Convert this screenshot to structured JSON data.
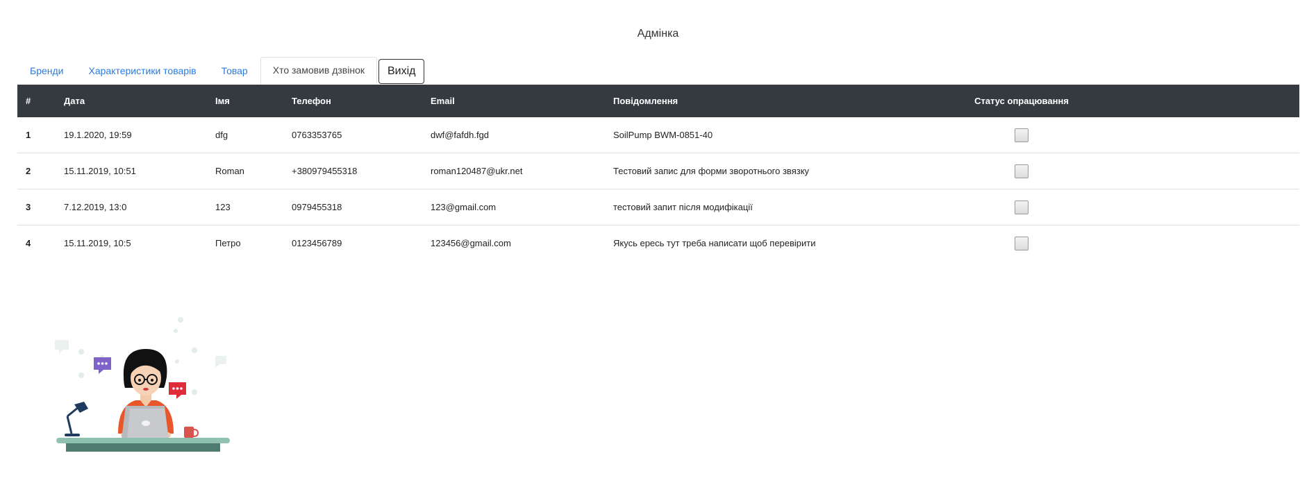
{
  "header": {
    "title": "Адмінка"
  },
  "tabs": [
    {
      "label": "Бренди",
      "active": false
    },
    {
      "label": "Характеристики товарів",
      "active": false
    },
    {
      "label": "Товар",
      "active": false
    },
    {
      "label": "Хто замовив дзвінок",
      "active": true
    }
  ],
  "logout_label": "Вихід",
  "table": {
    "columns": [
      "#",
      "Дата",
      "Імя",
      "Телефон",
      "Email",
      "Повідомлення",
      "Статус опрацювання"
    ],
    "rows": [
      {
        "num": "1",
        "date": "19.1.2020, 19:59",
        "name": "dfg",
        "phone": "0763353765",
        "email": "dwf@fafdh.fgd",
        "message": "SoilPump BWM-0851-40",
        "processed": false
      },
      {
        "num": "2",
        "date": "15.11.2019, 10:51",
        "name": "Roman",
        "phone": "+380979455318",
        "email": "roman120487@ukr.net",
        "message": "Тестовий запис для форми зворотнього звязку",
        "processed": false
      },
      {
        "num": "3",
        "date": "7.12.2019, 13:0",
        "name": "123",
        "phone": "0979455318",
        "email": "123@gmail.com",
        "message": "тестовий запит після модифікації",
        "processed": false
      },
      {
        "num": "4",
        "date": "15.11.2019, 10:5",
        "name": "Петро",
        "phone": "0123456789",
        "email": "123456@gmail.com",
        "message": "Якусь ересь тут треба написати щоб перевірити",
        "processed": false
      }
    ]
  },
  "colors": {
    "header_bg": "#343a40",
    "link": "#2a7ae2",
    "chat_purple": "#7f63c9",
    "chat_red": "#e02a3a",
    "shirt": "#e8562a"
  }
}
